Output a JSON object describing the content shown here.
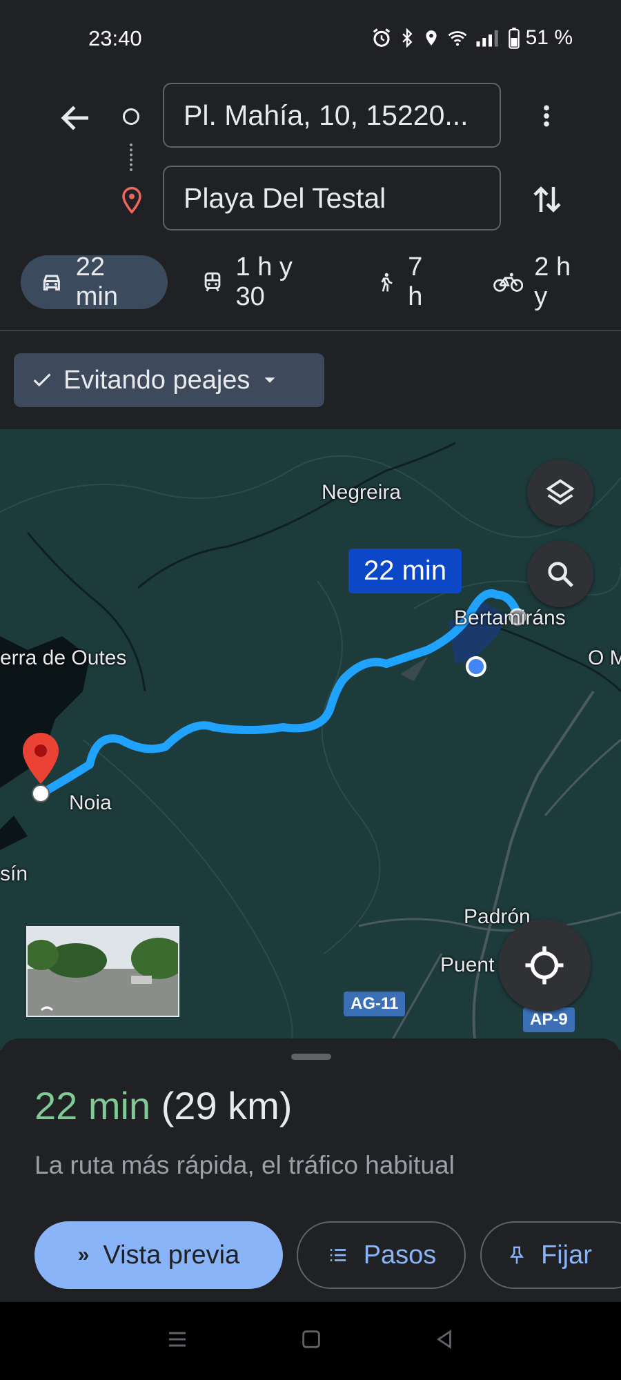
{
  "status_bar": {
    "time": "23:40",
    "battery": "51 %"
  },
  "header": {
    "origin": "Pl. Mahía, 10, 15220...",
    "destination": "Playa Del Testal"
  },
  "modes": [
    {
      "icon": "car-icon",
      "label": "22 min",
      "active": true
    },
    {
      "icon": "train-icon",
      "label": "1 h y 30"
    },
    {
      "icon": "walk-icon",
      "label": "7 h"
    },
    {
      "icon": "bike-icon",
      "label": "2 h y"
    }
  ],
  "options": {
    "avoid_tolls": "Evitando peajes"
  },
  "map": {
    "route_time": "22 min",
    "labels": {
      "negreira": "Negreira",
      "bertamirans": "Bertamiráns",
      "outes": "erra de Outes",
      "noia": "Noia",
      "sin": "sín",
      "padron": "Padrón",
      "puente": "Puent",
      "om": "O M"
    },
    "road_shields": [
      "AG-11",
      "AP-9"
    ]
  },
  "sheet": {
    "time": "22 min",
    "distance": "(29 km)",
    "description": "La ruta más rápida, el tráfico habitual",
    "preview_label": "Vista previa",
    "steps_label": "Pasos",
    "pin_label": "Fijar"
  },
  "colors": {
    "accent": "#8ab4f8",
    "trip_time": "#81c995",
    "route": "#1fa3ff",
    "destination_pin": "#ea4335"
  }
}
